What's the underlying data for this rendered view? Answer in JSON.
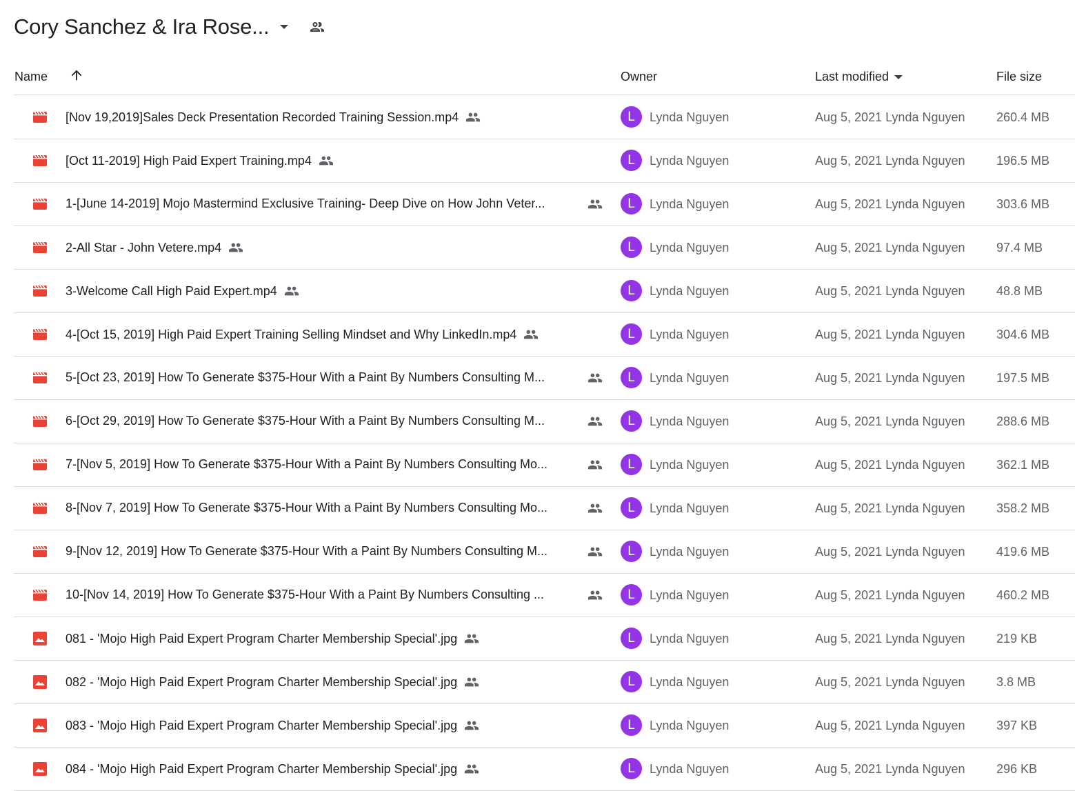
{
  "header": {
    "folder_title": "Cory Sanchez & Ira Rose...",
    "dropdown_icon": "arrow-drop-down-icon",
    "shared_icon": "people-outline-icon"
  },
  "columns": {
    "name": "Name",
    "owner": "Owner",
    "last_modified": "Last modified",
    "file_size": "File size",
    "sort_direction": "ascending"
  },
  "colors": {
    "video_icon": "#ea4335",
    "image_icon": "#ea4335",
    "avatar": "#9334e6"
  },
  "files": [
    {
      "type": "video",
      "name": "[Nov 19,2019]Sales Deck Presentation Recorded Training Session.mp4",
      "truncated": false,
      "owner_initial": "L",
      "owner": "Lynda Nguyen",
      "modified": "Aug 5, 2021 Lynda Nguyen",
      "size": "260.4 MB"
    },
    {
      "type": "video",
      "name": "[Oct 11-2019] High Paid Expert Training.mp4",
      "truncated": false,
      "owner_initial": "L",
      "owner": "Lynda Nguyen",
      "modified": "Aug 5, 2021 Lynda Nguyen",
      "size": "196.5 MB"
    },
    {
      "type": "video",
      "name": "1-[June 14-2019] Mojo Mastermind Exclusive Training- Deep Dive on How John Veter...",
      "truncated": true,
      "owner_initial": "L",
      "owner": "Lynda Nguyen",
      "modified": "Aug 5, 2021 Lynda Nguyen",
      "size": "303.6 MB"
    },
    {
      "type": "video",
      "name": "2-All Star - John Vetere.mp4",
      "truncated": false,
      "owner_initial": "L",
      "owner": "Lynda Nguyen",
      "modified": "Aug 5, 2021 Lynda Nguyen",
      "size": "97.4 MB"
    },
    {
      "type": "video",
      "name": "3-Welcome Call High Paid Expert.mp4",
      "truncated": false,
      "owner_initial": "L",
      "owner": "Lynda Nguyen",
      "modified": "Aug 5, 2021 Lynda Nguyen",
      "size": "48.8 MB"
    },
    {
      "type": "video",
      "name": "4-[Oct 15, 2019] High Paid Expert Training Selling Mindset and Why LinkedIn.mp4",
      "truncated": false,
      "owner_initial": "L",
      "owner": "Lynda Nguyen",
      "modified": "Aug 5, 2021 Lynda Nguyen",
      "size": "304.6 MB"
    },
    {
      "type": "video",
      "name": "5-[Oct 23, 2019] How To Generate $375-Hour With a Paint By Numbers Consulting M...",
      "truncated": true,
      "owner_initial": "L",
      "owner": "Lynda Nguyen",
      "modified": "Aug 5, 2021 Lynda Nguyen",
      "size": "197.5 MB"
    },
    {
      "type": "video",
      "name": "6-[Oct 29, 2019] How To Generate $375-Hour With a Paint By Numbers Consulting M...",
      "truncated": true,
      "owner_initial": "L",
      "owner": "Lynda Nguyen",
      "modified": "Aug 5, 2021 Lynda Nguyen",
      "size": "288.6 MB"
    },
    {
      "type": "video",
      "name": "7-[Nov 5, 2019] How To Generate $375-Hour With a Paint By Numbers Consulting Mo...",
      "truncated": true,
      "owner_initial": "L",
      "owner": "Lynda Nguyen",
      "modified": "Aug 5, 2021 Lynda Nguyen",
      "size": "362.1 MB"
    },
    {
      "type": "video",
      "name": "8-[Nov 7, 2019] How To Generate $375-Hour With a Paint By Numbers Consulting Mo...",
      "truncated": true,
      "owner_initial": "L",
      "owner": "Lynda Nguyen",
      "modified": "Aug 5, 2021 Lynda Nguyen",
      "size": "358.2 MB"
    },
    {
      "type": "video",
      "name": "9-[Nov 12, 2019] How To Generate $375-Hour With a Paint By Numbers Consulting M...",
      "truncated": true,
      "owner_initial": "L",
      "owner": "Lynda Nguyen",
      "modified": "Aug 5, 2021 Lynda Nguyen",
      "size": "419.6 MB"
    },
    {
      "type": "video",
      "name": "10-[Nov 14, 2019] How To Generate $375-Hour With a Paint By Numbers Consulting ...",
      "truncated": true,
      "owner_initial": "L",
      "owner": "Lynda Nguyen",
      "modified": "Aug 5, 2021 Lynda Nguyen",
      "size": "460.2 MB"
    },
    {
      "type": "image",
      "name": "081 - 'Mojo High Paid Expert Program Charter Membership Special'.jpg",
      "truncated": false,
      "owner_initial": "L",
      "owner": "Lynda Nguyen",
      "modified": "Aug 5, 2021 Lynda Nguyen",
      "size": "219 KB"
    },
    {
      "type": "image",
      "name": "082 - 'Mojo High Paid Expert Program Charter Membership Special'.jpg",
      "truncated": false,
      "owner_initial": "L",
      "owner": "Lynda Nguyen",
      "modified": "Aug 5, 2021 Lynda Nguyen",
      "size": "3.8 MB"
    },
    {
      "type": "image",
      "name": "083 - 'Mojo High Paid Expert Program Charter Membership Special'.jpg",
      "truncated": false,
      "owner_initial": "L",
      "owner": "Lynda Nguyen",
      "modified": "Aug 5, 2021 Lynda Nguyen",
      "size": "397 KB"
    },
    {
      "type": "image",
      "name": "084 - 'Mojo High Paid Expert Program Charter Membership Special'.jpg",
      "truncated": false,
      "owner_initial": "L",
      "owner": "Lynda Nguyen",
      "modified": "Aug 5, 2021 Lynda Nguyen",
      "size": "296 KB"
    }
  ]
}
